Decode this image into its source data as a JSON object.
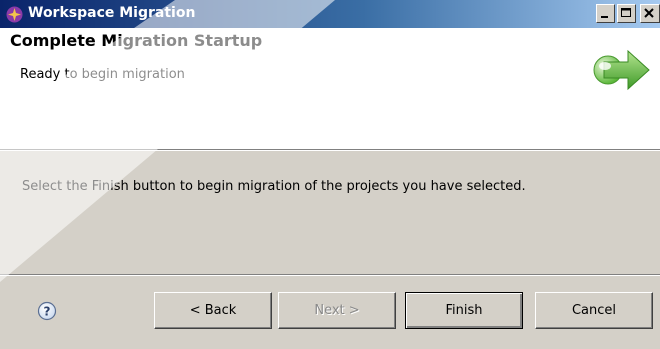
{
  "window": {
    "title": "Workspace Migration"
  },
  "header": {
    "title": "Complete Migration Startup",
    "subtitle": "Ready to begin migration"
  },
  "body": {
    "message": "Select the Finish button to begin migration of the projects you have selected."
  },
  "footer": {
    "back_label": "< Back",
    "next_label": "Next >",
    "finish_label": "Finish",
    "cancel_label": "Cancel"
  },
  "colors": {
    "title_bar": "#0a246a",
    "dialog_face": "#d4d0c8",
    "arrow_green": "#5cb83a"
  },
  "icons": [
    "app-icon",
    "minimize-icon",
    "maximize-icon",
    "close-icon",
    "wizard-arrow-icon",
    "help-icon"
  ]
}
